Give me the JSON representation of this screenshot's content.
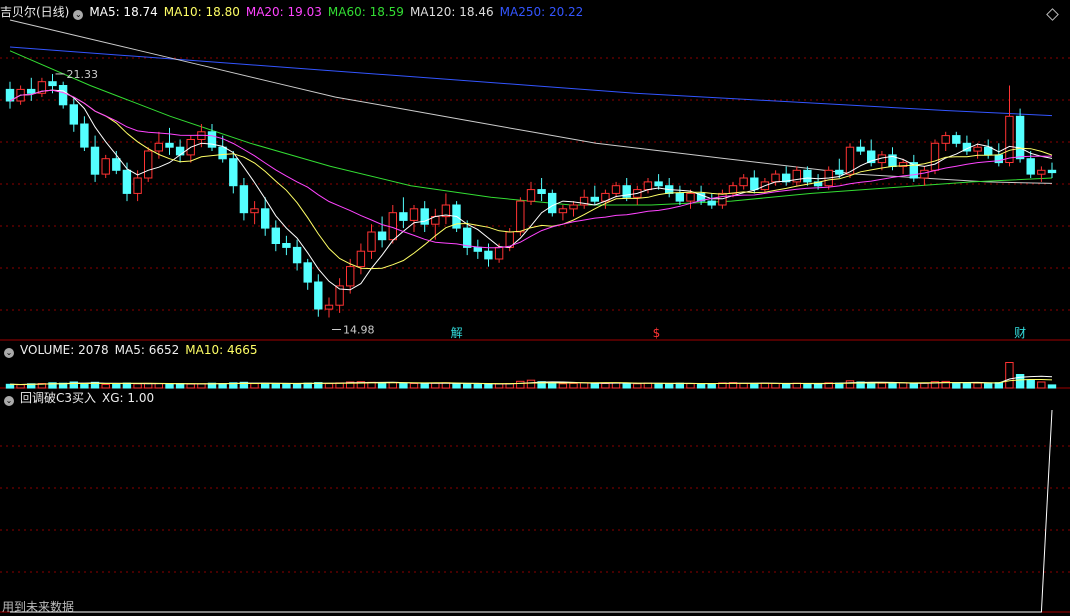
{
  "main": {
    "title": "吉贝尔(日线)",
    "ma": [
      {
        "label": "MA5: 18.74",
        "color": "#ffffff"
      },
      {
        "label": "MA10: 18.80",
        "color": "#ffff66"
      },
      {
        "label": "MA20: 19.03",
        "color": "#ff44ff"
      },
      {
        "label": "MA60: 18.59",
        "color": "#33dd33"
      },
      {
        "label": "MA120: 18.46",
        "color": "#dddddd"
      },
      {
        "label": "MA250: 20.22",
        "color": "#3355ff"
      }
    ],
    "high_label": "21.33",
    "low_label": "14.98",
    "markers": [
      {
        "text": "解",
        "color": "#33dddd"
      },
      {
        "text": "$",
        "color": "#ff3333"
      },
      {
        "text": "财",
        "color": "#33dddd"
      }
    ]
  },
  "volume": {
    "label": "VOLUME: 2078",
    "ma5": "MA5: 6652",
    "ma10": "MA10: 4665"
  },
  "indicator": {
    "label": "回调破C3买入",
    "xg": "XG: 1.00"
  },
  "footer": "用到未来数据",
  "colors": {
    "up": "#ff3333",
    "down": "#54ffff",
    "grid": "#8b0000",
    "frame": "#a00000"
  },
  "chart_data": {
    "type": "candlestick",
    "title": "吉贝尔(日线)",
    "price_range": [
      14.5,
      22.7
    ],
    "ohlc": [
      [
        20.9,
        21.1,
        20.4,
        20.6
      ],
      [
        20.6,
        21.0,
        20.5,
        20.9
      ],
      [
        20.9,
        21.2,
        20.6,
        20.8
      ],
      [
        20.8,
        21.2,
        20.7,
        21.1
      ],
      [
        21.1,
        21.3,
        20.8,
        21.0
      ],
      [
        21.0,
        21.1,
        20.4,
        20.5
      ],
      [
        20.5,
        20.7,
        19.8,
        20.0
      ],
      [
        20.0,
        20.2,
        19.3,
        19.4
      ],
      [
        19.4,
        19.7,
        18.5,
        18.7
      ],
      [
        18.7,
        19.2,
        18.6,
        19.1
      ],
      [
        19.1,
        19.3,
        18.7,
        18.8
      ],
      [
        18.8,
        19.0,
        18.0,
        18.2
      ],
      [
        18.2,
        18.8,
        18.0,
        18.6
      ],
      [
        18.6,
        19.4,
        18.5,
        19.3
      ],
      [
        19.3,
        19.8,
        19.1,
        19.5
      ],
      [
        19.5,
        19.9,
        19.2,
        19.4
      ],
      [
        19.4,
        19.6,
        19.0,
        19.2
      ],
      [
        19.2,
        19.7,
        19.0,
        19.6
      ],
      [
        19.6,
        20.0,
        19.4,
        19.8
      ],
      [
        19.8,
        20.0,
        19.3,
        19.4
      ],
      [
        19.4,
        19.7,
        19.0,
        19.1
      ],
      [
        19.1,
        19.3,
        18.2,
        18.4
      ],
      [
        18.4,
        18.6,
        17.5,
        17.7
      ],
      [
        17.7,
        18.0,
        17.4,
        17.8
      ],
      [
        17.8,
        18.1,
        17.1,
        17.3
      ],
      [
        17.3,
        17.5,
        16.7,
        16.9
      ],
      [
        16.9,
        17.1,
        16.6,
        16.8
      ],
      [
        16.8,
        17.0,
        16.2,
        16.4
      ],
      [
        16.4,
        16.5,
        15.7,
        15.9
      ],
      [
        15.9,
        16.1,
        15.0,
        15.2
      ],
      [
        15.2,
        15.5,
        14.98,
        15.3
      ],
      [
        15.3,
        16.0,
        15.1,
        15.8
      ],
      [
        15.8,
        16.5,
        15.6,
        16.3
      ],
      [
        16.3,
        16.9,
        16.1,
        16.7
      ],
      [
        16.7,
        17.4,
        16.5,
        17.2
      ],
      [
        17.2,
        17.6,
        16.8,
        17.0
      ],
      [
        17.0,
        17.9,
        16.9,
        17.7
      ],
      [
        17.7,
        18.1,
        17.3,
        17.5
      ],
      [
        17.5,
        17.9,
        17.2,
        17.8
      ],
      [
        17.8,
        18.0,
        17.2,
        17.4
      ],
      [
        17.4,
        17.8,
        17.0,
        17.6
      ],
      [
        17.6,
        18.2,
        17.4,
        17.9
      ],
      [
        17.9,
        18.0,
        17.2,
        17.3
      ],
      [
        17.3,
        17.5,
        16.6,
        16.8
      ],
      [
        16.8,
        17.0,
        16.5,
        16.7
      ],
      [
        16.7,
        16.9,
        16.3,
        16.5
      ],
      [
        16.5,
        16.9,
        16.4,
        16.8
      ],
      [
        16.8,
        17.3,
        16.7,
        17.2
      ],
      [
        17.2,
        18.1,
        17.1,
        18.0
      ],
      [
        18.0,
        18.5,
        17.9,
        18.3
      ],
      [
        18.3,
        18.6,
        18.0,
        18.2
      ],
      [
        18.2,
        18.3,
        17.6,
        17.7
      ],
      [
        17.7,
        17.9,
        17.5,
        17.8
      ],
      [
        17.8,
        18.0,
        17.6,
        17.9
      ],
      [
        17.9,
        18.3,
        17.8,
        18.1
      ],
      [
        18.1,
        18.4,
        17.9,
        18.0
      ],
      [
        18.0,
        18.3,
        17.8,
        18.2
      ],
      [
        18.2,
        18.5,
        18.1,
        18.4
      ],
      [
        18.4,
        18.6,
        18.0,
        18.1
      ],
      [
        18.1,
        18.4,
        17.9,
        18.3
      ],
      [
        18.3,
        18.6,
        18.2,
        18.5
      ],
      [
        18.5,
        18.7,
        18.3,
        18.4
      ],
      [
        18.4,
        18.6,
        18.1,
        18.2
      ],
      [
        18.2,
        18.4,
        17.9,
        18.0
      ],
      [
        18.0,
        18.3,
        17.8,
        18.2
      ],
      [
        18.2,
        18.4,
        17.9,
        18.0
      ],
      [
        18.0,
        18.2,
        17.8,
        17.9
      ],
      [
        17.9,
        18.3,
        17.8,
        18.2
      ],
      [
        18.2,
        18.5,
        18.1,
        18.4
      ],
      [
        18.4,
        18.7,
        18.3,
        18.6
      ],
      [
        18.6,
        18.8,
        18.2,
        18.3
      ],
      [
        18.3,
        18.6,
        18.2,
        18.5
      ],
      [
        18.5,
        18.8,
        18.4,
        18.7
      ],
      [
        18.7,
        18.9,
        18.4,
        18.5
      ],
      [
        18.5,
        18.9,
        18.4,
        18.8
      ],
      [
        18.8,
        18.9,
        18.4,
        18.5
      ],
      [
        18.5,
        18.7,
        18.3,
        18.4
      ],
      [
        18.4,
        18.9,
        18.3,
        18.8
      ],
      [
        18.8,
        19.1,
        18.6,
        18.7
      ],
      [
        18.7,
        19.5,
        18.6,
        19.4
      ],
      [
        19.4,
        19.6,
        19.2,
        19.3
      ],
      [
        19.3,
        19.6,
        18.9,
        19.0
      ],
      [
        19.0,
        19.3,
        18.8,
        19.2
      ],
      [
        19.2,
        19.4,
        18.8,
        18.9
      ],
      [
        18.9,
        19.1,
        18.7,
        19.0
      ],
      [
        19.0,
        19.2,
        18.5,
        18.6
      ],
      [
        18.6,
        18.9,
        18.4,
        18.8
      ],
      [
        18.8,
        19.6,
        18.7,
        19.5
      ],
      [
        19.5,
        19.8,
        19.3,
        19.7
      ],
      [
        19.7,
        19.8,
        19.4,
        19.5
      ],
      [
        19.5,
        19.7,
        19.2,
        19.3
      ],
      [
        19.3,
        19.5,
        19.1,
        19.4
      ],
      [
        19.4,
        19.6,
        19.1,
        19.2
      ],
      [
        19.2,
        19.5,
        18.9,
        19.0
      ],
      [
        19.0,
        21.0,
        18.9,
        20.2
      ],
      [
        20.2,
        20.4,
        19.0,
        19.1
      ],
      [
        19.1,
        19.3,
        18.6,
        18.7
      ],
      [
        18.7,
        18.9,
        18.5,
        18.8
      ],
      [
        18.8,
        19.0,
        18.6,
        18.74
      ]
    ],
    "volume_scale_max": 20000,
    "volume": [
      2500,
      2200,
      2800,
      3000,
      3500,
      3200,
      4000,
      2600,
      3800,
      2400,
      2800,
      3300,
      2700,
      3100,
      2900,
      2500,
      3000,
      2600,
      2800,
      3200,
      3000,
      3500,
      3800,
      2900,
      3100,
      2700,
      3000,
      2800,
      3300,
      3600,
      2900,
      3400,
      4000,
      4200,
      3800,
      3300,
      3600,
      3100,
      3000,
      2800,
      3200,
      3500,
      3000,
      2900,
      2600,
      2400,
      2700,
      3000,
      4500,
      5200,
      4200,
      3300,
      2800,
      3100,
      3500,
      3200,
      3000,
      3400,
      3100,
      2800,
      3300,
      3000,
      2800,
      3200,
      2900,
      2700,
      3000,
      3400,
      3600,
      3100,
      2800,
      3300,
      3000,
      2600,
      3200,
      2900,
      2700,
      3500,
      3300,
      4800,
      4000,
      3600,
      3200,
      3000,
      3400,
      2800,
      3200,
      4200,
      4400,
      3500,
      3100,
      3300,
      3000,
      3600,
      17000,
      9000,
      5500,
      4000,
      2078
    ],
    "volume_ma5": 6652,
    "volume_ma10": 4665,
    "xg": [
      0,
      0,
      0,
      0,
      0,
      0,
      0,
      0,
      0,
      0,
      0,
      0,
      0,
      0,
      0,
      0,
      0,
      0,
      0,
      0,
      0,
      0,
      0,
      0,
      0,
      0,
      0,
      0,
      0,
      0,
      0,
      0,
      0,
      0,
      0,
      0,
      0,
      0,
      0,
      0,
      0,
      0,
      0,
      0,
      0,
      0,
      0,
      0,
      0,
      0,
      0,
      0,
      0,
      0,
      0,
      0,
      0,
      0,
      0,
      0,
      0,
      0,
      0,
      0,
      0,
      0,
      0,
      0,
      0,
      0,
      0,
      0,
      0,
      0,
      0,
      0,
      0,
      0,
      0,
      0,
      0,
      0,
      0,
      0,
      0,
      0,
      0,
      0,
      0,
      0,
      0,
      0,
      0,
      0,
      0,
      0,
      0,
      0,
      1
    ],
    "xg_range": [
      0,
      1
    ],
    "ma_periods": [
      5,
      10,
      20
    ],
    "ma60": [
      21.9,
      21.0,
      20.2,
      19.5,
      18.9,
      18.4,
      18.1,
      17.9,
      17.9,
      18.0,
      18.2,
      18.35,
      18.5,
      18.6
    ],
    "ma120": [
      22.7,
      22.3,
      21.9,
      21.5,
      21.1,
      20.7,
      20.4,
      20.1,
      19.8,
      19.5,
      19.3,
      19.1,
      18.9,
      18.7,
      18.6,
      18.5,
      18.46
    ],
    "ma250": [
      22.0,
      21.8,
      21.6,
      21.4,
      21.2,
      21.0,
      20.8,
      20.65,
      20.5,
      20.35,
      20.22
    ]
  }
}
